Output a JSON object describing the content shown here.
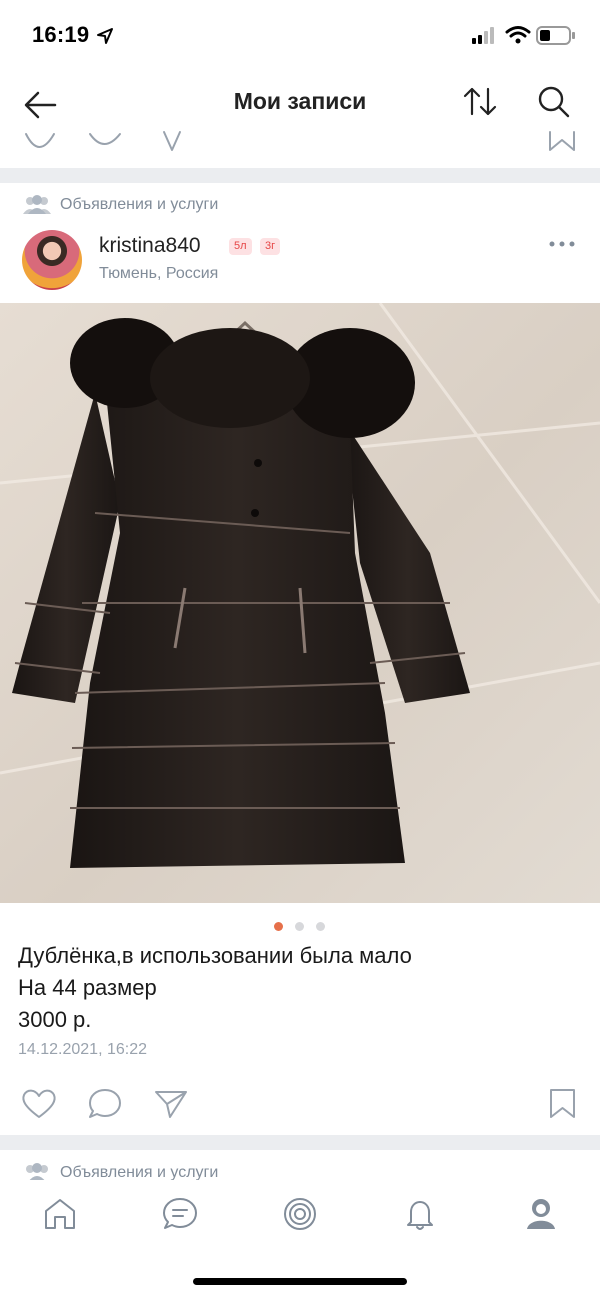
{
  "status_bar": {
    "time": "16:19"
  },
  "header": {
    "title": "Мои записи"
  },
  "post": {
    "group_label": "Объявления и услуги",
    "author": "kristina840",
    "badges": [
      "5л",
      "3г"
    ],
    "location": "Тюмень, Россия",
    "lines": [
      "Дублёнка,в использовании была мало",
      "На 44 размер",
      "3000 р."
    ],
    "date": "14.12.2021, 16:22",
    "photo_pages": 3,
    "photo_active": 1
  },
  "next_post": {
    "group_label": "Объявления и услуги"
  },
  "colors": {
    "accent_dot": "#e6704a",
    "link_gray": "#818c99",
    "band": "#ebedf0"
  },
  "bottom_nav": [
    "home-icon",
    "messages-icon",
    "services-icon",
    "notifications-icon",
    "profile-icon"
  ]
}
